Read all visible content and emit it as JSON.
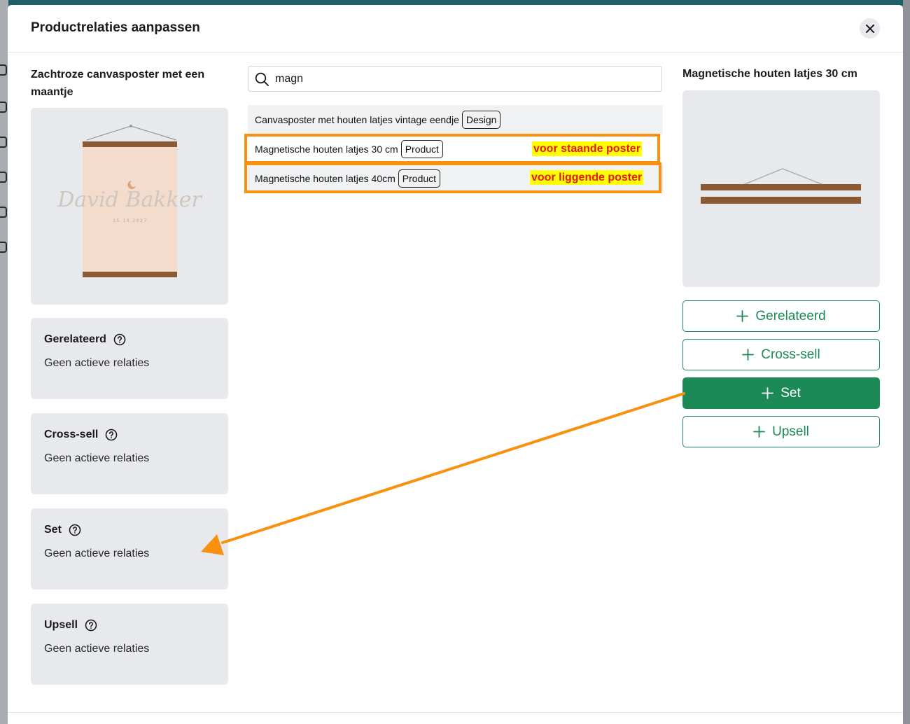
{
  "modal": {
    "title": "Productrelaties aanpassen"
  },
  "source_product": {
    "title": "Zachtroze canvasposter met een maantje",
    "poster_name": "David Bakker",
    "poster_date": "15.10.2027"
  },
  "relations": [
    {
      "label": "Gerelateerd",
      "status": "Geen actieve relaties"
    },
    {
      "label": "Cross-sell",
      "status": "Geen actieve relaties"
    },
    {
      "label": "Set",
      "status": "Geen actieve relaties"
    },
    {
      "label": "Upsell",
      "status": "Geen actieve relaties"
    }
  ],
  "search": {
    "value": "magn"
  },
  "results": [
    {
      "name": "Canvasposter met houten latjes vintage eendje",
      "tag": "Design"
    },
    {
      "name": "Magnetische houten latjes 30 cm",
      "tag": "Product"
    },
    {
      "name": "Magnetische houten latjes 40cm",
      "tag": "Product"
    }
  ],
  "annotations": {
    "note_standing": "voor staande poster",
    "note_lying": "voor liggende poster",
    "accent_color": "#f7910f",
    "note_text_color": "#e8161d",
    "note_highlight": "#ffff00"
  },
  "selected_product": {
    "title": "Magnetische houten latjes 30 cm"
  },
  "actions": [
    {
      "label": "Gerelateerd",
      "primary": false
    },
    {
      "label": "Cross-sell",
      "primary": false
    },
    {
      "label": "Set",
      "primary": true
    },
    {
      "label": "Upsell",
      "primary": false
    }
  ],
  "colors": {
    "brand_green": "#1b8a57",
    "card_bg": "#e7e9ec"
  },
  "icons": {
    "close": "close-icon",
    "search": "search-icon",
    "help": "help-circle-icon",
    "plus": "plus-icon"
  }
}
